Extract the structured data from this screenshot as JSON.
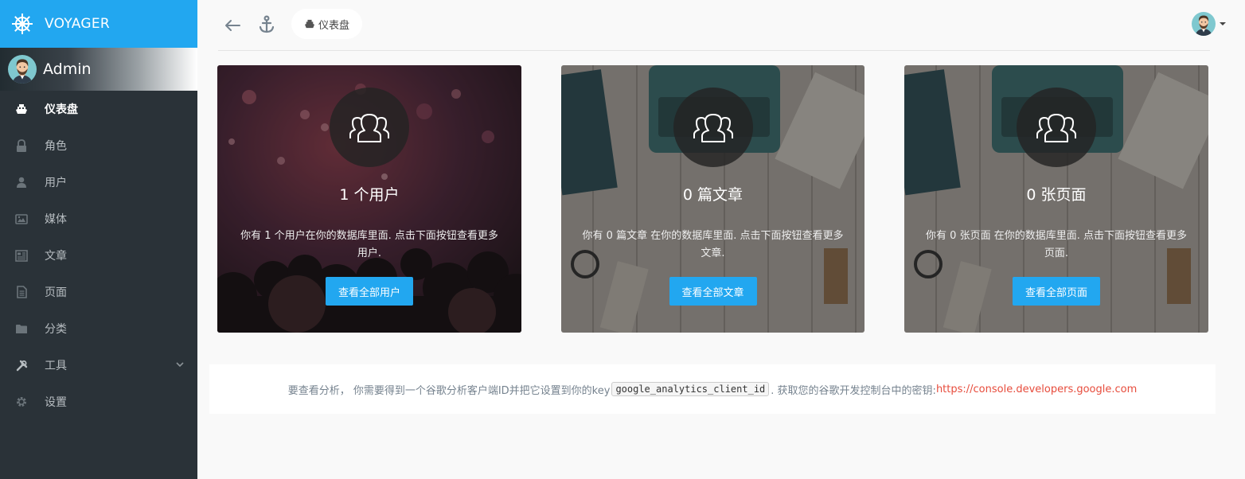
{
  "brand": {
    "name": "VOYAGER",
    "color": "#22a7f0"
  },
  "profile": {
    "name": "Admin"
  },
  "sidebar": {
    "items": [
      {
        "label": "仪表盘",
        "icon": "boat-icon",
        "active": true
      },
      {
        "label": "角色",
        "icon": "lock-icon"
      },
      {
        "label": "用户",
        "icon": "person-icon"
      },
      {
        "label": "媒体",
        "icon": "images-icon"
      },
      {
        "label": "文章",
        "icon": "news-icon"
      },
      {
        "label": "页面",
        "icon": "file-icon"
      },
      {
        "label": "分类",
        "icon": "folder-icon"
      },
      {
        "label": "工具",
        "icon": "tools-icon",
        "has_submenu": true
      },
      {
        "label": "设置",
        "icon": "gear-icon"
      }
    ]
  },
  "topbar": {
    "breadcrumb": "仪表盘"
  },
  "cards": [
    {
      "title": "1 个用户",
      "text": "你有 1 个用户在你的数据库里面. 点击下面按钮查看更多用户.",
      "button": "查看全部用户",
      "icon": "users-icon"
    },
    {
      "title": "0 篇文章",
      "text": "你有 0 篇文章 在你的数据库里面. 点击下面按钮查看更多文章.",
      "button": "查看全部文章",
      "icon": "users-icon"
    },
    {
      "title": "0 张页面",
      "text": "你有 0 张页面 在你的数据库里面. 点击下面按钮查看更多页面.",
      "button": "查看全部页面",
      "icon": "users-icon"
    }
  ],
  "analytics": {
    "text_before": "要查看分析， 你需要得到一个谷歌分析客户端ID并把它设置到你的key",
    "key": "google_analytics_client_id",
    "text_after": ". 获取您的谷歌开发控制台中的密钥: ",
    "link": "https://console.developers.google.com",
    "link_color": "#e74c3c"
  }
}
